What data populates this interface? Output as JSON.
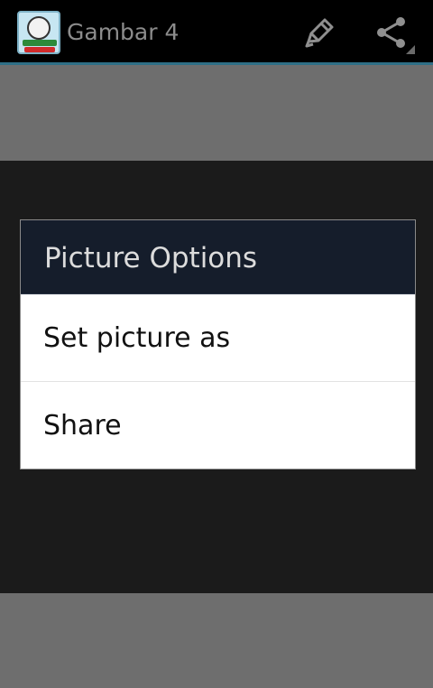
{
  "action_bar": {
    "title": "Gambar 4",
    "app_icon": "app-logo-icon",
    "actions": [
      {
        "name": "edit",
        "icon": "pencil-icon"
      },
      {
        "name": "share",
        "icon": "share-icon"
      }
    ]
  },
  "dialog": {
    "title": "Picture Options",
    "options": [
      {
        "label": "Set picture as"
      },
      {
        "label": "Share"
      }
    ]
  },
  "colors": {
    "action_bar_bg": "#000000",
    "accent_line": "#2e6f86",
    "dialog_header_bg": "#151d2b",
    "dim_background": "#6e6e6e",
    "content_bg": "#1b1b1b"
  }
}
